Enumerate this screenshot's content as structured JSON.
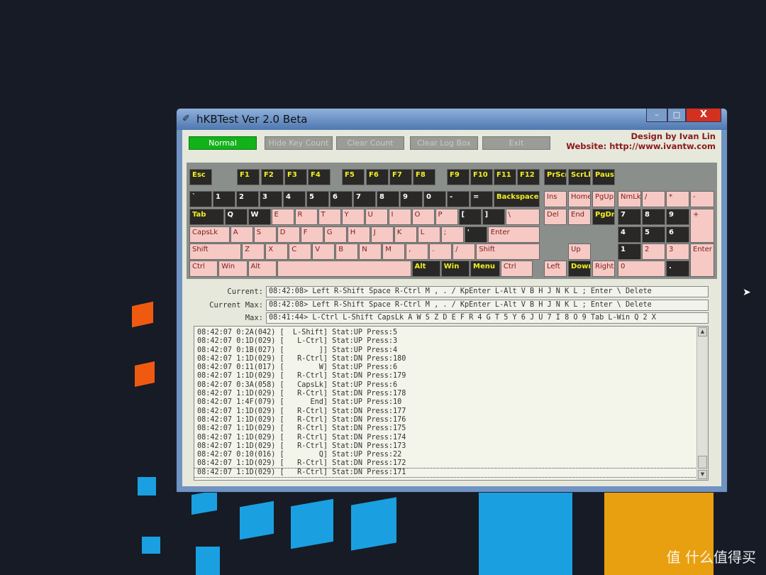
{
  "window": {
    "title": "hKBTest Ver 2.0 Beta",
    "minimize": "–",
    "maximize": "□",
    "close": "X"
  },
  "toolbar": {
    "normal": "Normal",
    "hide_key_count": "Hide Key Count",
    "clear_count": "Clear Count",
    "clear_log_box": "Clear Log Box",
    "exit": "Exit"
  },
  "credits": {
    "design": "Design by Ivan Lin",
    "website": "Website: http://www.ivantw.com"
  },
  "colors": {
    "pressed": "#f7c9c4",
    "unpressed": "#2a2826",
    "highlight_label": "#f0f020",
    "normal_button": "#12b21a"
  },
  "keyboard": {
    "frow": [
      {
        "label": "Esc",
        "state": "dark-yellow"
      },
      {
        "label": "F1",
        "state": "dark-yellow"
      },
      {
        "label": "F2",
        "state": "dark-yellow"
      },
      {
        "label": "F3",
        "state": "dark-yellow"
      },
      {
        "label": "F4",
        "state": "dark-yellow"
      },
      {
        "label": "F5",
        "state": "dark-yellow"
      },
      {
        "label": "F6",
        "state": "dark-yellow"
      },
      {
        "label": "F7",
        "state": "dark-yellow"
      },
      {
        "label": "F8",
        "state": "dark-yellow"
      },
      {
        "label": "F9",
        "state": "dark-yellow"
      },
      {
        "label": "F10",
        "state": "dark-yellow"
      },
      {
        "label": "F11",
        "state": "dark-yellow"
      },
      {
        "label": "F12",
        "state": "dark-yellow"
      },
      {
        "label": "PrScr",
        "state": "dark-yellow"
      },
      {
        "label": "ScrLk",
        "state": "dark-yellow"
      },
      {
        "label": "Pause",
        "state": "dark-yellow"
      }
    ],
    "main": [
      [
        {
          "label": "`",
          "state": "dark"
        },
        {
          "label": "1",
          "state": "dark"
        },
        {
          "label": "2",
          "state": "dark"
        },
        {
          "label": "3",
          "state": "dark"
        },
        {
          "label": "4",
          "state": "dark"
        },
        {
          "label": "5",
          "state": "dark"
        },
        {
          "label": "6",
          "state": "dark"
        },
        {
          "label": "7",
          "state": "dark"
        },
        {
          "label": "8",
          "state": "dark"
        },
        {
          "label": "9",
          "state": "dark"
        },
        {
          "label": "0",
          "state": "dark"
        },
        {
          "label": "-",
          "state": "dark"
        },
        {
          "label": "=",
          "state": "dark"
        },
        {
          "label": "Backspace",
          "state": "dark-yellow"
        }
      ],
      [
        {
          "label": "Tab",
          "state": "dark-yellow"
        },
        {
          "label": "Q",
          "state": "dark"
        },
        {
          "label": "W",
          "state": "dark"
        },
        {
          "label": "E",
          "state": "pink"
        },
        {
          "label": "R",
          "state": "pink"
        },
        {
          "label": "T",
          "state": "pink"
        },
        {
          "label": "Y",
          "state": "pink"
        },
        {
          "label": "U",
          "state": "pink"
        },
        {
          "label": "I",
          "state": "pink"
        },
        {
          "label": "O",
          "state": "pink"
        },
        {
          "label": "P",
          "state": "pink"
        },
        {
          "label": "[",
          "state": "dark"
        },
        {
          "label": "]",
          "state": "dark"
        },
        {
          "label": "\\",
          "state": "pink"
        }
      ],
      [
        {
          "label": "CapsLk",
          "state": "pink"
        },
        {
          "label": "A",
          "state": "pink"
        },
        {
          "label": "S",
          "state": "pink"
        },
        {
          "label": "D",
          "state": "pink"
        },
        {
          "label": "F",
          "state": "pink"
        },
        {
          "label": "G",
          "state": "pink"
        },
        {
          "label": "H",
          "state": "pink"
        },
        {
          "label": "J",
          "state": "pink"
        },
        {
          "label": "K",
          "state": "pink"
        },
        {
          "label": "L",
          "state": "pink"
        },
        {
          "label": ";",
          "state": "pink"
        },
        {
          "label": "'",
          "state": "dark"
        },
        {
          "label": "Enter",
          "state": "pink"
        }
      ],
      [
        {
          "label": "Shift",
          "state": "pink"
        },
        {
          "label": "Z",
          "state": "pink"
        },
        {
          "label": "X",
          "state": "pink"
        },
        {
          "label": "C",
          "state": "pink"
        },
        {
          "label": "V",
          "state": "pink"
        },
        {
          "label": "B",
          "state": "pink"
        },
        {
          "label": "N",
          "state": "pink"
        },
        {
          "label": "M",
          "state": "pink"
        },
        {
          "label": ",",
          "state": "pink"
        },
        {
          "label": ".",
          "state": "pink"
        },
        {
          "label": "/",
          "state": "pink"
        },
        {
          "label": "Shift",
          "state": "pink"
        }
      ],
      [
        {
          "label": "Ctrl",
          "state": "pink"
        },
        {
          "label": "Win",
          "state": "pink"
        },
        {
          "label": "Alt",
          "state": "pink"
        },
        {
          "label": "",
          "state": "pink"
        },
        {
          "label": "Alt",
          "state": "dark-yellow"
        },
        {
          "label": "Win",
          "state": "dark-yellow"
        },
        {
          "label": "Menu",
          "state": "dark-yellow"
        },
        {
          "label": "Ctrl",
          "state": "pink"
        }
      ]
    ],
    "nav": [
      {
        "label": "Ins",
        "state": "pink"
      },
      {
        "label": "Home",
        "state": "pink"
      },
      {
        "label": "PgUp",
        "state": "pink"
      },
      {
        "label": "Del",
        "state": "pink"
      },
      {
        "label": "End",
        "state": "pink"
      },
      {
        "label": "PgDn",
        "state": "dark-yellow"
      },
      {
        "label": "Up",
        "state": "pink"
      },
      {
        "label": "Left",
        "state": "pink"
      },
      {
        "label": "Down",
        "state": "dark-yellow"
      },
      {
        "label": "Right",
        "state": "pink"
      }
    ],
    "numpad": [
      {
        "label": "NmLk",
        "state": "pink"
      },
      {
        "label": "/",
        "state": "pink"
      },
      {
        "label": "*",
        "state": "pink"
      },
      {
        "label": "-",
        "state": "pink"
      },
      {
        "label": "7",
        "state": "dark"
      },
      {
        "label": "8",
        "state": "dark"
      },
      {
        "label": "9",
        "state": "dark"
      },
      {
        "label": "+",
        "state": "pink"
      },
      {
        "label": "4",
        "state": "dark"
      },
      {
        "label": "5",
        "state": "dark"
      },
      {
        "label": "6",
        "state": "dark"
      },
      {
        "label": "1",
        "state": "dark"
      },
      {
        "label": "2",
        "state": "pink"
      },
      {
        "label": "3",
        "state": "pink"
      },
      {
        "label": "Enter",
        "state": "pink"
      },
      {
        "label": "0",
        "state": "pink"
      },
      {
        "label": ".",
        "state": "dark"
      }
    ]
  },
  "status": {
    "current_label": "Current:",
    "current": "08:42:08> Left R-Shift Space R-Ctrl M , . / KpEnter L-Alt V B H J N K L ; Enter \\ Delete",
    "current_max_label": "Current Max:",
    "current_max": "08:42:08> Left R-Shift Space R-Ctrl M , . / KpEnter L-Alt V B H J N K L ; Enter \\ Delete",
    "max_label": "Max:",
    "max": "08:41:44> L-Ctrl L-Shift CapsLk A W S Z D E F R 4 G T 5 Y 6 J U 7 I 8 O 9 Tab L-Win Q 2 X"
  },
  "log": [
    "08:42:07 0:2A(042) [  L-Shift] Stat:UP Press:5",
    "08:42:07 0:1D(029) [   L-Ctrl] Stat:UP Press:3",
    "08:42:07 0:1B(027) [        ]] Stat:UP Press:4",
    "08:42:07 1:1D(029) [   R-Ctrl] Stat:DN Press:180",
    "08:42:07 0:11(017) [        W] Stat:UP Press:6",
    "08:42:07 1:1D(029) [   R-Ctrl] Stat:DN Press:179",
    "08:42:07 0:3A(058) [   CapsLk] Stat:UP Press:6",
    "08:42:07 1:1D(029) [   R-Ctrl] Stat:DN Press:178",
    "08:42:07 1:4F(079) [      End] Stat:UP Press:10",
    "08:42:07 1:1D(029) [   R-Ctrl] Stat:DN Press:177",
    "08:42:07 1:1D(029) [   R-Ctrl] Stat:DN Press:176",
    "08:42:07 1:1D(029) [   R-Ctrl] Stat:DN Press:175",
    "08:42:07 1:1D(029) [   R-Ctrl] Stat:DN Press:174",
    "08:42:07 1:1D(029) [   R-Ctrl] Stat:DN Press:173",
    "08:42:07 0:10(016) [        Q] Stat:UP Press:22",
    "08:42:07 1:1D(029) [   R-Ctrl] Stat:DN Press:172",
    "08:42:07 1:1D(029) [   R-Ctrl] Stat:DN Press:171"
  ],
  "watermark": "值 什么值得买"
}
